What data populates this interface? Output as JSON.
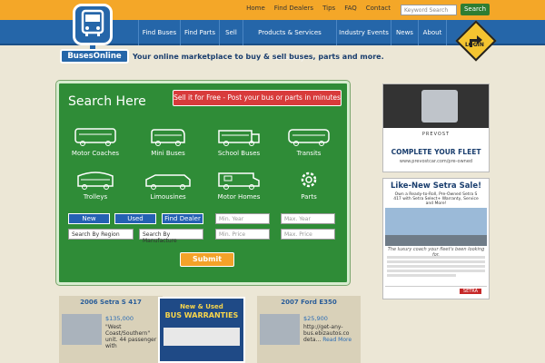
{
  "header": {
    "links": [
      "Home",
      "Find Dealers",
      "Tips",
      "FAQ",
      "Contact"
    ],
    "search_placeholder": "Keyword Search",
    "search_button": "Search"
  },
  "nav": {
    "items": [
      "Find Buses",
      "Find Parts",
      "Sell",
      "Products & Services Directory",
      "Industry Events",
      "News",
      "About"
    ]
  },
  "logo": {
    "text": "BusesOnline"
  },
  "tagline": "Your online marketplace to buy & sell buses, parts and more.",
  "login": "LOGIN",
  "search_panel": {
    "title": "Search Here",
    "sell_button": "Sell it for Free - Post your bus or parts in minutes",
    "categories": [
      "Motor Coaches",
      "Mini Buses",
      "School Buses",
      "Transits",
      "Trolleys",
      "Limousines",
      "Motor Homes",
      "Parts"
    ],
    "buttons": [
      "New",
      "Used",
      "Find Dealer"
    ],
    "selects": [
      "Search By Region",
      "Search By Manufacture"
    ],
    "inputs": [
      "Min. Year",
      "Max. Year",
      "Min. Price",
      "Max. Price"
    ],
    "submit": "Submit"
  },
  "ads": {
    "prevost": {
      "brand": "PREVOST",
      "headline": "COMPLETE YOUR FLEET",
      "url": "www.prevostcar.com/pre-owned"
    },
    "setra": {
      "headline": "Like-New Setra Sale!",
      "sub": "Own a Ready-to-Roll, Pre-Owned Setra S 417 with Setra Select+ Warranty, Service and More!",
      "tag": "The luxury coach your fleet's been looking for.",
      "brand": "SETRA"
    }
  },
  "listings": [
    {
      "title": "2006 Setra S 417",
      "price": "$135,000",
      "desc": "\"West Coast/Southern\" unit. 44 passenger with",
      "more": ""
    },
    {
      "title": "",
      "price": "",
      "desc": "",
      "more": ""
    },
    {
      "title": "2007 Ford E350",
      "price": "$25,900",
      "desc": "http://get-any-bus.ebizautos.co deta...",
      "more": "Read More"
    }
  ],
  "warranty_ad": {
    "line1": "New & Used",
    "line2": "BUS WARRANTIES"
  }
}
